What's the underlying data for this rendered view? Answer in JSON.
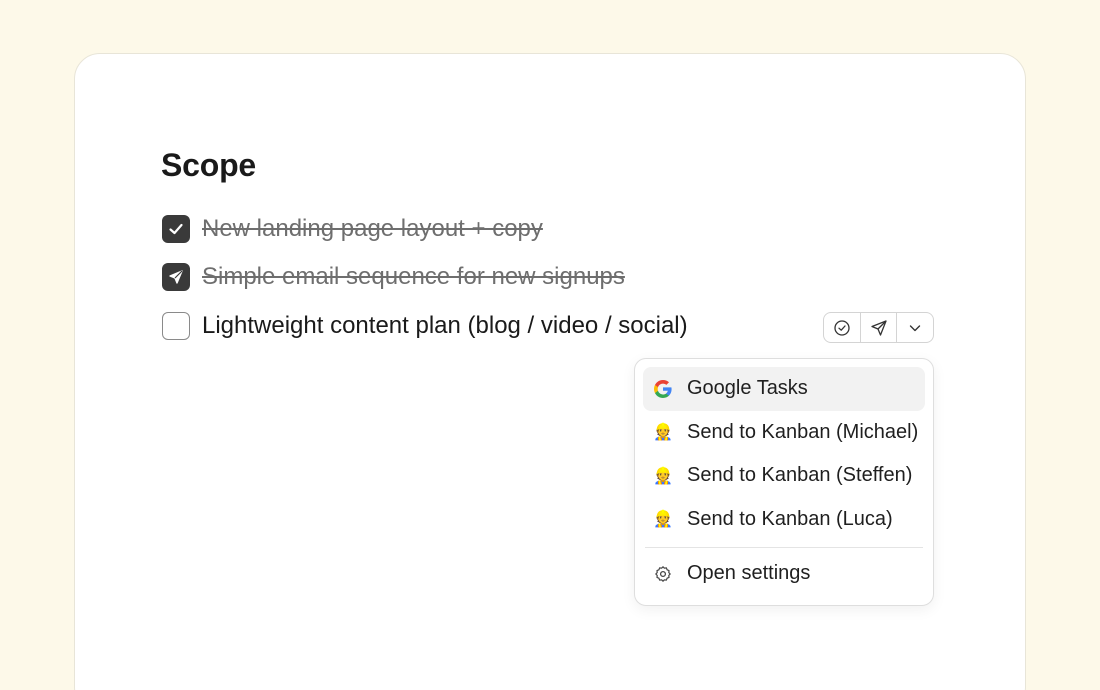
{
  "section": {
    "title": "Scope"
  },
  "tasks": [
    {
      "label": "New landing page layout + copy",
      "status": "done",
      "box_icon": "check-icon"
    },
    {
      "label": "Simple email sequence for new signups",
      "status": "sent",
      "box_icon": "paper-plane-icon"
    },
    {
      "label": "Lightweight content plan (blog / video / social)",
      "status": "open",
      "box_icon": ""
    }
  ],
  "task_actions": [
    {
      "name": "complete-task-button",
      "icon": "check-circle-icon"
    },
    {
      "name": "send-task-button",
      "icon": "paper-plane-icon"
    },
    {
      "name": "more-options-button",
      "icon": "chevron-down-icon"
    }
  ],
  "menu": {
    "items": [
      {
        "label": "Google Tasks",
        "icon": "google-icon",
        "active": true
      },
      {
        "label": "Send to Kanban (Michael)",
        "icon": "construction-worker-icon",
        "emoji": "👷"
      },
      {
        "label": "Send to Kanban (Steffen)",
        "icon": "construction-worker-icon",
        "emoji": "👷"
      },
      {
        "label": "Send to Kanban (Luca)",
        "icon": "construction-worker-icon",
        "emoji": "👷"
      }
    ],
    "settings": {
      "label": "Open settings",
      "icon": "gear-icon"
    }
  },
  "colors": {
    "page_background": "#fdf9e9",
    "card_background": "#ffffff",
    "checkbox_checked": "#3a3a3a",
    "done_text": "#6e6e6e",
    "menu_active": "#f2f2f2"
  }
}
